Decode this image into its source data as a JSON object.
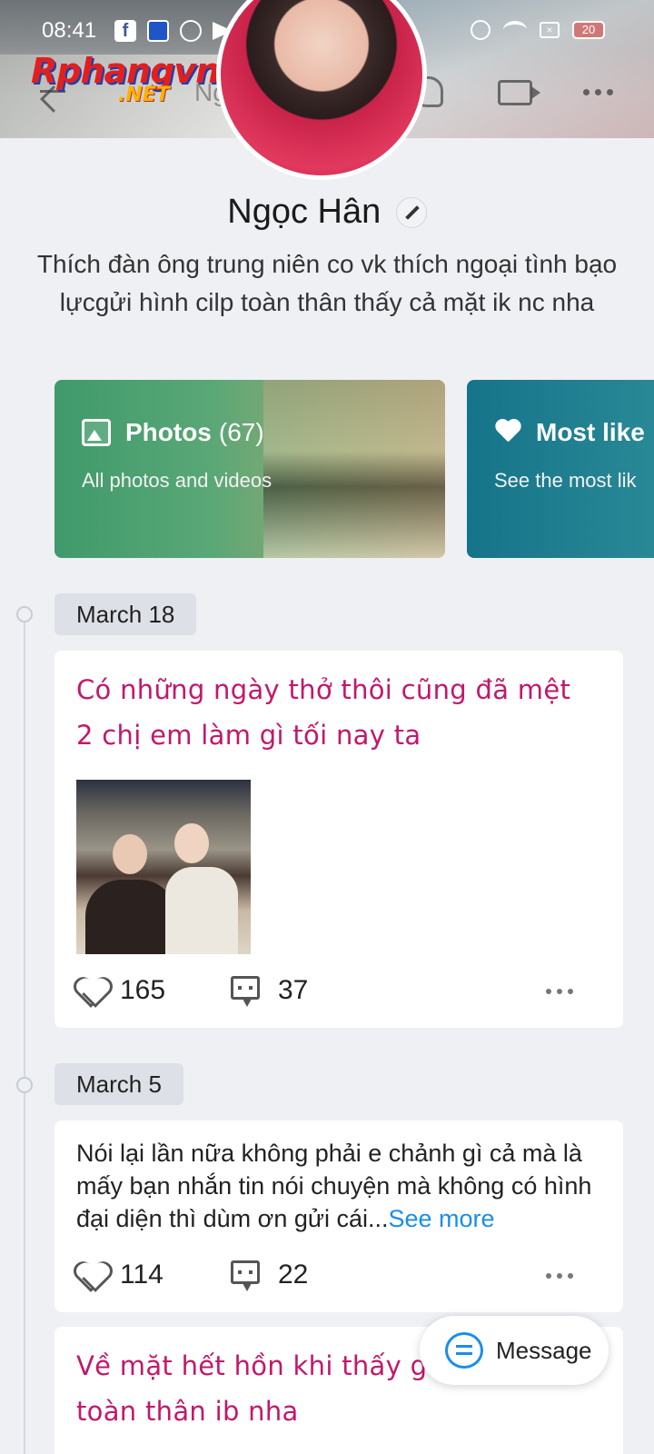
{
  "status_bar": {
    "time": "08:41",
    "battery": "20"
  },
  "watermark": {
    "top": "Rphangvn",
    "bottom": ".NET"
  },
  "header": {
    "title": "Ngọc Hân"
  },
  "profile": {
    "name": "Ngọc Hân",
    "bio": "Thích đàn ông trung niên co vk thích ngoại tình bạo lựcgửi hình cilp toàn thân thấy cả mặt ik nc nha"
  },
  "albums": [
    {
      "title": "Photos",
      "count": "(67)",
      "subtitle": "All photos and videos",
      "icon": "image-icon"
    },
    {
      "title": "Most like",
      "subtitle": "See the most lik",
      "icon": "heart-icon"
    }
  ],
  "posts": [
    {
      "date": "March 18",
      "lines": [
        "Có những ngày thở thôi cũng đã mệt",
        "2 chị em làm gì tối nay ta"
      ],
      "has_photo": true,
      "likes": "165",
      "comments": "37"
    },
    {
      "date": "March 5",
      "text": "Nói lại lần nữa không phải e chảnh gì cả mà là mấy bạn nhắn tin nói chuyện mà không có hình đại diện thì dùm ơn gửi cái...",
      "see_more": "See more",
      "likes": "114",
      "comments": "22"
    },
    {
      "lines": [
        "Về mặt hết hồn khi thấy gì c",
        "toàn thân ib nha"
      ]
    }
  ],
  "message_button": {
    "label": "Message"
  },
  "colors": {
    "accent": "#1a8ee8",
    "decorative_text": "#c2186b",
    "photos_card": "#3f9a6c",
    "liked_card": "#157489"
  }
}
